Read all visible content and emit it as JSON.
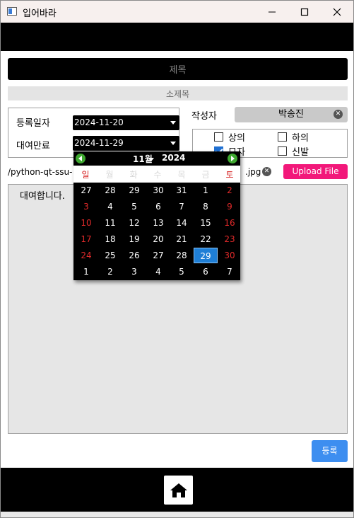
{
  "window": {
    "title": "입어바라",
    "controls": [
      "minimize",
      "maximize",
      "close"
    ]
  },
  "form": {
    "title_placeholder": "제목",
    "subtitle_placeholder": "소제목",
    "reg_date_label": "등록일자",
    "reg_date_value": "2024-11-20",
    "due_date_label": "대여만료",
    "due_date_value": "2024-11-29",
    "author_label": "작성자",
    "author_value": "박송진",
    "categories": [
      {
        "label": "상의",
        "checked": false
      },
      {
        "label": "하의",
        "checked": false
      },
      {
        "label": "모자",
        "checked": true
      },
      {
        "label": "신발",
        "checked": false
      }
    ],
    "file_path_start": "/python-qt-ssu-",
    "file_path_end": ".jpg",
    "upload_label": "Upload File",
    "content_text": "대여합니다.",
    "register_label": "등록"
  },
  "calendar": {
    "month": "11월",
    "year": "2024",
    "weekdays": [
      "일",
      "월",
      "화",
      "수",
      "목",
      "금",
      "토"
    ],
    "selected_day": "29",
    "weeks": [
      [
        "27",
        "28",
        "29",
        "30",
        "31",
        "1",
        "2"
      ],
      [
        "3",
        "4",
        "5",
        "6",
        "7",
        "8",
        "9"
      ],
      [
        "10",
        "11",
        "12",
        "13",
        "14",
        "15",
        "16"
      ],
      [
        "17",
        "18",
        "19",
        "20",
        "21",
        "22",
        "23"
      ],
      [
        "24",
        "25",
        "26",
        "27",
        "28",
        "29",
        "30"
      ],
      [
        "1",
        "2",
        "3",
        "4",
        "5",
        "6",
        "7"
      ]
    ]
  },
  "icons": {
    "home": "home-icon",
    "prev": "left-arrow-icon",
    "next": "right-arrow-icon",
    "clear": "clear-icon"
  },
  "colors": {
    "upload_button": "#f2187a",
    "register_button": "#3d8ef0",
    "weekend_red": "#e02a2a",
    "selected_day": "#1f7fd6",
    "checkbox_checked": "#1f6fd1"
  }
}
